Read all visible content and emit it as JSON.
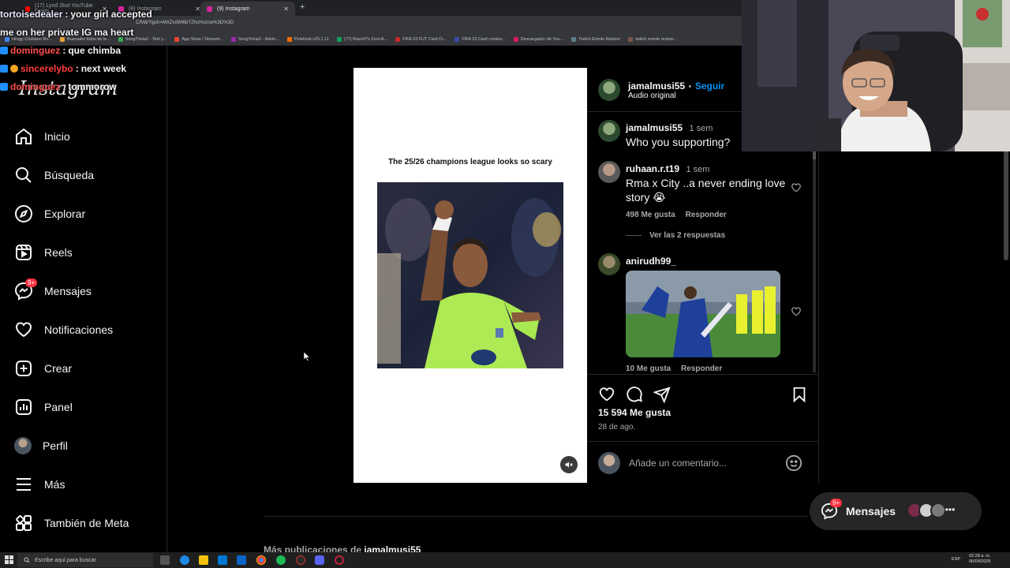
{
  "browser": {
    "tabs": [
      {
        "title": "(17) Lynd 2kut YouTube Down"
      },
      {
        "title": "(8) Instagram"
      },
      {
        "title": "(9) Instagram"
      }
    ],
    "url": "C/Md/?igsh=MXZvdWl6bTZhcHozcw%3D%3D",
    "bookmarks": [
      "Hrogy Cristiano Ro...",
      "Buscador fotos de le...",
      "SongTrivia2 - Test y...",
      "App Store / Streami...",
      "SongTrivia2 - Advin...",
      "Peletoob v25.1.11",
      "(77) Razo97s Zest-A...",
      "FIFA 23 FUT Card Cr...",
      "FIFA 23 Card creator...",
      "Descargador de You...",
      "Twitch Emote Resizer",
      "twitch emote resizer..."
    ]
  },
  "chat": [
    {
      "user": "tortoisedealer",
      "sep": " : ",
      "msg": "your girl accepted"
    },
    {
      "user": "",
      "sep": "",
      "msg": "me on her private IG ma heart"
    },
    {
      "user": "dominguez",
      "sep": " : ",
      "msg": "que chimba"
    },
    {
      "user": "sincerelybo",
      "sep": " : ",
      "msg": "next week"
    },
    {
      "user": "dominguez",
      "sep": " : ",
      "msg": "tommorow"
    }
  ],
  "sidebar": {
    "logo": "Instagram",
    "items": [
      {
        "label": "Inicio",
        "icon": "home-icon"
      },
      {
        "label": "Búsqueda",
        "icon": "search-icon"
      },
      {
        "label": "Explorar",
        "icon": "compass-icon"
      },
      {
        "label": "Reels",
        "icon": "reels-icon"
      },
      {
        "label": "Mensajes",
        "icon": "messenger-icon",
        "badge": "9+"
      },
      {
        "label": "Notificaciones",
        "icon": "heart-icon"
      },
      {
        "label": "Crear",
        "icon": "plus-square-icon"
      },
      {
        "label": "Panel",
        "icon": "chart-icon"
      },
      {
        "label": "Perfil",
        "icon": "avatar"
      },
      {
        "label": "Más",
        "icon": "menu-icon"
      },
      {
        "label": "También de Meta",
        "icon": "meta-grid-icon"
      }
    ]
  },
  "post": {
    "caption": "The 25/26 champions league looks so scary",
    "author": "jamalmusi55",
    "dot": "•",
    "follow": "Seguir",
    "audio": "Audio original",
    "likes": "15 594 Me gusta",
    "date": "28 de ago.",
    "comment_placeholder": "Añade un comentario..."
  },
  "comments": [
    {
      "user": "jamalmusi55",
      "time": "1 sem",
      "text": "Who you supporting?"
    },
    {
      "user": "ruhaan.r.t19",
      "time": "1 sem",
      "text": "Rma x City ..a never ending love story 😭",
      "likes": "498 Me gusta",
      "reply": "Responder",
      "replies": "Ver las 2 respuestas"
    },
    {
      "user": "anirudh99_",
      "time": "",
      "text": "",
      "likes": "10 Me gusta",
      "reply": "Responder"
    }
  ],
  "more_posts": {
    "prefix": "Más publicaciones de ",
    "user": "jamalmusi55"
  },
  "messages_pill": {
    "label": "Mensajes",
    "badge": "9+"
  },
  "taskbar": {
    "search_placeholder": "Escribe aquí para buscar",
    "lang": "ESP",
    "time": "02:28 a. m.",
    "date": "06/09/2025"
  },
  "colors": {
    "accent": "#0095f6",
    "badge": "#ff3040",
    "background": "#000000"
  }
}
